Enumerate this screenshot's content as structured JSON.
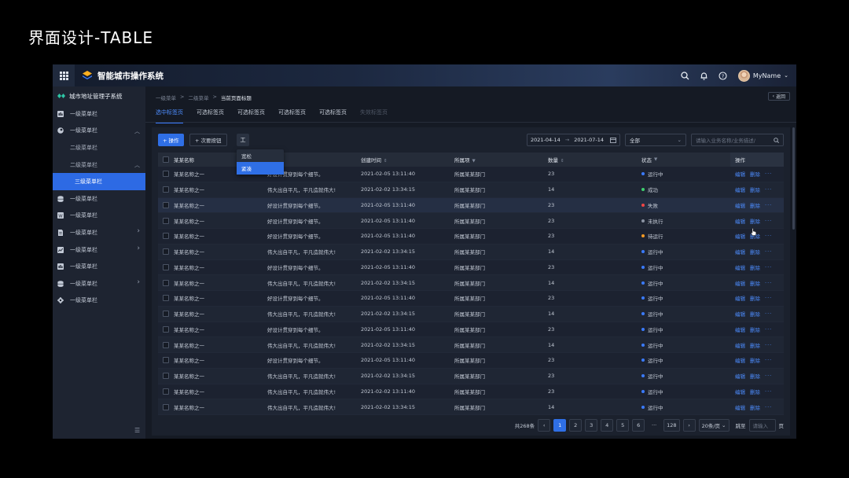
{
  "page_title": "界面设计-TABLE",
  "app": {
    "title": "智能城市操作系统",
    "user_name": "MyName",
    "subsystem": "城市地址管理子系统",
    "accent": "#2f6fe6"
  },
  "sidebar": {
    "items": [
      {
        "label": "一级菜单栏",
        "icon": "grid-icon"
      },
      {
        "label": "一级菜单栏",
        "icon": "circle-icon",
        "expanded": true
      },
      {
        "label": "二级菜单栏",
        "sub": true
      },
      {
        "label": "二级菜单栏",
        "sub": true,
        "expanded": true
      },
      {
        "label": "三级菜单栏",
        "active": true
      },
      {
        "label": "一级菜单栏",
        "icon": "database-icon"
      },
      {
        "label": "一级菜单栏",
        "icon": "document-icon"
      },
      {
        "label": "一级菜单栏",
        "icon": "file-icon",
        "arrow": true
      },
      {
        "label": "一级菜单栏",
        "icon": "chart-icon",
        "arrow": true
      },
      {
        "label": "一级菜单栏",
        "icon": "grid-icon"
      },
      {
        "label": "一级菜单栏",
        "icon": "database-icon",
        "arrow": true
      },
      {
        "label": "一级菜单栏",
        "icon": "gear-icon"
      }
    ]
  },
  "breadcrumb": {
    "level1": "一级菜单",
    "level2": "二级菜单",
    "current": "当前页面标题",
    "sep": ">"
  },
  "back_label": "返回",
  "tabs": [
    {
      "label": "选中标签页",
      "state": "active"
    },
    {
      "label": "可选标签页",
      "state": "normal"
    },
    {
      "label": "可选标签页",
      "state": "normal"
    },
    {
      "label": "可选标签页",
      "state": "normal"
    },
    {
      "label": "可选标签页",
      "state": "normal"
    },
    {
      "label": "失效标签页",
      "state": "disabled"
    }
  ],
  "toolbar": {
    "primary_label": "+ 操作",
    "secondary_label": "+ 次要按钮",
    "density_glyph": "工",
    "density_options": [
      {
        "label": "宽松"
      },
      {
        "label": "紧凑"
      }
    ],
    "date_start": "2021-04-14",
    "date_arrow": "→",
    "date_end": "2021-07-14",
    "status_filter": "全部",
    "search_placeholder": "请输入业务名称/业务描述/"
  },
  "table": {
    "headers": [
      "某某名称",
      "",
      "创建时间",
      "所属项",
      "数量",
      "状态",
      "操作"
    ],
    "action_edit": "编辑",
    "action_delete": "删除",
    "action_more": "···",
    "status_colors": {
      "运行中": "#3a7bff",
      "成功": "#3ecf6e",
      "失败": "#f04545",
      "未执行": "#8a93a3",
      "待运行": "#f59a23"
    },
    "rows": [
      {
        "name": "某某名称之一",
        "desc": "好设计贯穿到每个细节。",
        "time": "2021-02-05 13:11:40",
        "dept": "所属某某部门",
        "qty": "23",
        "status": "运行中"
      },
      {
        "name": "某某名称之一",
        "desc": "伟大出自平凡，平凡造就伟大!",
        "time": "2021-02-02 13:34:15",
        "dept": "所属某某部门",
        "qty": "14",
        "status": "成功"
      },
      {
        "name": "某某名称之一",
        "desc": "好设计贯穿到每个细节。",
        "time": "2021-02-05 13:11:40",
        "dept": "所属某某部门",
        "qty": "23",
        "status": "失败"
      },
      {
        "name": "某某名称之一",
        "desc": "好设计贯穿到每个细节。",
        "time": "2021-02-05 13:11:40",
        "dept": "所属某某部门",
        "qty": "23",
        "status": "未执行"
      },
      {
        "name": "某某名称之一",
        "desc": "好设计贯穿到每个细节。",
        "time": "2021-02-05 13:11:40",
        "dept": "所属某某部门",
        "qty": "23",
        "status": "待运行"
      },
      {
        "name": "某某名称之一",
        "desc": "伟大出自平凡，平凡造就伟大!",
        "time": "2021-02-02 13:34:15",
        "dept": "所属某某部门",
        "qty": "14",
        "status": "运行中"
      },
      {
        "name": "某某名称之一",
        "desc": "好设计贯穿到每个细节。",
        "time": "2021-02-05 13:11:40",
        "dept": "所属某某部门",
        "qty": "23",
        "status": "运行中"
      },
      {
        "name": "某某名称之一",
        "desc": "伟大出自平凡，平凡造就伟大!",
        "time": "2021-02-02 13:34:15",
        "dept": "所属某某部门",
        "qty": "14",
        "status": "运行中"
      },
      {
        "name": "某某名称之一",
        "desc": "好设计贯穿到每个细节。",
        "time": "2021-02-05 13:11:40",
        "dept": "所属某某部门",
        "qty": "23",
        "status": "运行中"
      },
      {
        "name": "某某名称之一",
        "desc": "伟大出自平凡，平凡造就伟大!",
        "time": "2021-02-02 13:34:15",
        "dept": "所属某某部门",
        "qty": "14",
        "status": "运行中"
      },
      {
        "name": "某某名称之一",
        "desc": "好设计贯穿到每个细节。",
        "time": "2021-02-05 13:11:40",
        "dept": "所属某某部门",
        "qty": "23",
        "status": "运行中"
      },
      {
        "name": "某某名称之一",
        "desc": "伟大出自平凡，平凡造就伟大!",
        "time": "2021-02-02 13:34:15",
        "dept": "所属某某部门",
        "qty": "14",
        "status": "运行中"
      },
      {
        "name": "某某名称之一",
        "desc": "好设计贯穿到每个细节。",
        "time": "2021-02-05 13:11:40",
        "dept": "所属某某部门",
        "qty": "23",
        "status": "运行中"
      },
      {
        "name": "某某名称之一",
        "desc": "伟大出自平凡，平凡造就伟大!",
        "time": "2021-02-02 13:34:15",
        "dept": "所属某某部门",
        "qty": "23",
        "status": "运行中"
      },
      {
        "name": "某某名称之一",
        "desc": "伟大出自平凡，平凡造就伟大!",
        "time": "2021-02-02 13:11:40",
        "dept": "所属某某部门",
        "qty": "23",
        "status": "运行中"
      },
      {
        "name": "某某名称之一",
        "desc": "伟大出自平凡，平凡造就伟大!",
        "time": "2021-02-02 13:34:15",
        "dept": "所属某某部门",
        "qty": "14",
        "status": "运行中"
      }
    ]
  },
  "pagination": {
    "total": "共268条",
    "pages": [
      "1",
      "2",
      "3",
      "4",
      "5",
      "6"
    ],
    "ellipsis": "···",
    "last": "128",
    "page_size": "20条/页",
    "jump_label": "跳至",
    "jump_placeholder": "请输入",
    "page_unit": "页",
    "prev": "‹",
    "next": "›"
  }
}
